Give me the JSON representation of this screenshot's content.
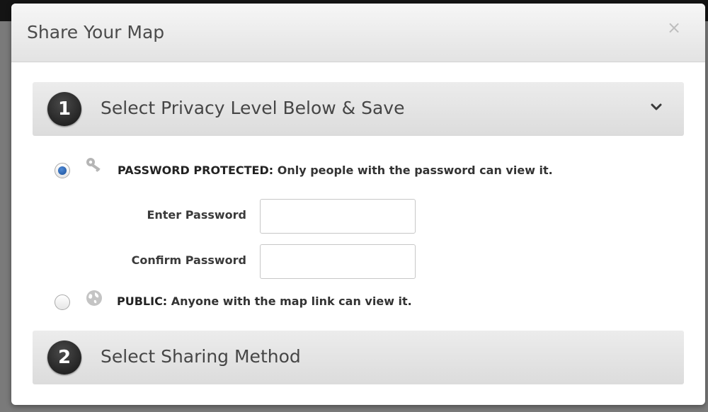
{
  "modal": {
    "title": "Share Your Map",
    "close_label": "×"
  },
  "steps": [
    {
      "number": "1",
      "label": "Select Privacy Level Below & Save",
      "icon": "chevron-down-icon"
    },
    {
      "number": "2",
      "label": "Select Sharing Method"
    }
  ],
  "privacy": {
    "password_option": {
      "title": "PASSWORD PROTECTED:",
      "description": " Only people with the password can view it.",
      "icon": "key-icon",
      "selected": true
    },
    "enter_password_label": "Enter Password",
    "enter_password_value": "",
    "confirm_password_label": "Confirm Password",
    "confirm_password_value": "",
    "public_option": {
      "title": "PUBLIC:",
      "description": " Anyone with the map link can view it.",
      "icon": "globe-icon",
      "selected": false
    }
  },
  "colors": {
    "radio_selected": "#1a4f99",
    "step_badge": "#1e1e1e"
  }
}
